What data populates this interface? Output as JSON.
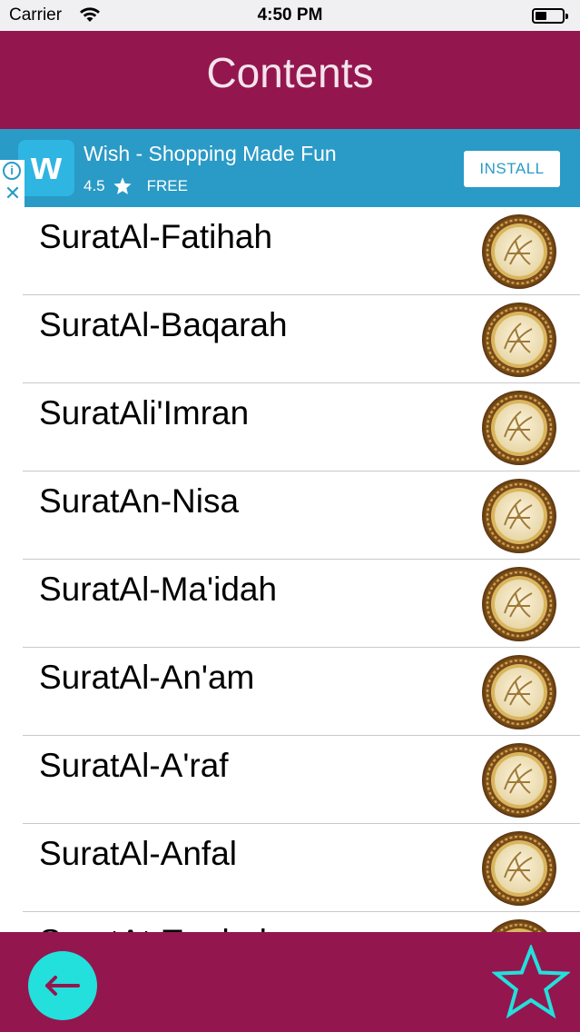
{
  "status_bar": {
    "carrier": "Carrier",
    "time": "4:50 PM"
  },
  "nav": {
    "title": "Contents"
  },
  "ad": {
    "app_icon_letter": "w",
    "title": "Wish - Shopping Made Fun",
    "rating": "4.5",
    "price": "FREE",
    "install_label": "INSTALL",
    "info_glyph": "i",
    "close_glyph": "✕"
  },
  "surahs": [
    {
      "label": "SuratAl-Fatihah"
    },
    {
      "label": "SuratAl-Baqarah"
    },
    {
      "label": "SuratAli'Imran"
    },
    {
      "label": "SuratAn-Nisa"
    },
    {
      "label": "SuratAl-Ma'idah"
    },
    {
      "label": "SuratAl-An'am"
    },
    {
      "label": "SuratAl-A'raf"
    },
    {
      "label": "SuratAl-Anfal"
    },
    {
      "label": "SuratAt-Tawbah"
    }
  ],
  "tab_bar": {
    "back_icon": "back-arrow-icon",
    "favorite_icon": "star-outline-icon"
  },
  "colors": {
    "primary": "#94164f",
    "ad_blue": "#2a9ac6",
    "accent_cyan": "#23e0dc"
  }
}
